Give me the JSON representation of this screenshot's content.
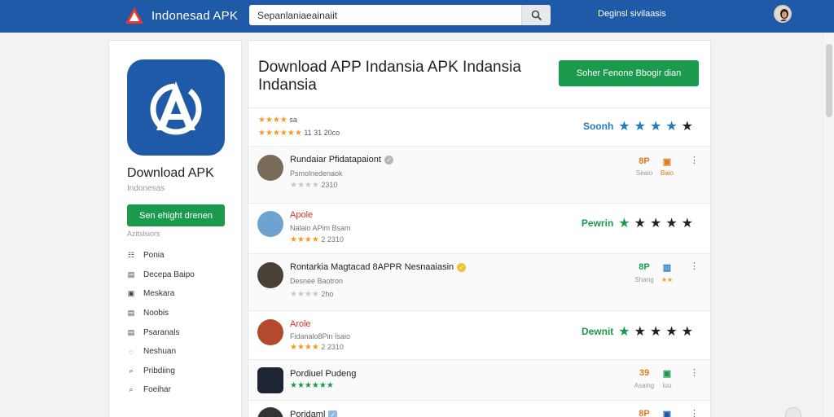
{
  "header": {
    "brand": "Indonesad APK",
    "search_value": "Sepanlaniaeainaiit",
    "link": "Deginsl sivilaasis"
  },
  "left": {
    "app_title": "Download APK",
    "app_sub": "Indonesas",
    "download_label": "Sen ehight drenen",
    "categories_heading": "Azitslsiors",
    "categories": [
      {
        "icon": "grid-icon",
        "glyph": "☷",
        "label": "Ponia"
      },
      {
        "icon": "calendar-icon",
        "glyph": "▤",
        "label": "Decepa Baipo"
      },
      {
        "icon": "media-icon",
        "glyph": "▣",
        "label": "Meskara"
      },
      {
        "icon": "news-icon",
        "glyph": "▤",
        "label": "Noobis"
      },
      {
        "icon": "list-icon",
        "glyph": "▤",
        "label": "Psaranals"
      },
      {
        "icon": "circle-icon",
        "glyph": "◌",
        "label": "Neshuan"
      },
      {
        "icon": "search-icon",
        "glyph": "⌕",
        "label": "Pribdiing"
      },
      {
        "icon": "search-icon",
        "glyph": "⌕",
        "label": "Foeihar"
      }
    ]
  },
  "main": {
    "title": "Download APP Indansia APK Indansia Indansia",
    "primary_button": "Soher Fenone Bbogir dian",
    "summary": {
      "line1_text": "sa",
      "line2_text": "11  31  20co",
      "rate_label": "Soonh",
      "rate_color": "#1e7bc4"
    },
    "rows": [
      {
        "name": "Rundaiar Pfidatapaiont",
        "sub": "Psmolnedenaok",
        "stars_text": "2310",
        "name_red": false,
        "verify_color": "#b5b5b5",
        "right_type": "stat",
        "num": "8P",
        "num_color": "#e07b1f",
        "num_sub": "Seaio",
        "icon_glyph": "▣",
        "icon_color": "#e07b1f",
        "icon_sub": "Baio",
        "avatar_color": "#7a6a58",
        "avatar_shape": "round"
      },
      {
        "name": "Apole",
        "sub": "Nalaio APim  Bsam",
        "stars_text": "2  2310",
        "name_red": true,
        "right_type": "rate",
        "rate_label": "Pewrin",
        "rate_color": "#1b9a4d",
        "avatar_color": "#6fa3cf",
        "avatar_shape": "round"
      },
      {
        "name": "Rontarkia Magtacad 8APPR Nesnaaiasin",
        "sub": "Desnee Baotron",
        "stars_text": "2ho",
        "name_red": false,
        "verify_color": "#f1c232",
        "right_type": "stat",
        "num": "8P",
        "num_color": "#1b9a4d",
        "num_sub": "Shang",
        "icon_glyph": "▥",
        "icon_color": "#1e7bc4",
        "icon_sub": "★★",
        "avatar_color": "#4a4136",
        "avatar_shape": "round"
      },
      {
        "name": "Arole",
        "sub": "Fidanalo8Pin  Isaio",
        "stars_text": "2  2310",
        "name_red": true,
        "right_type": "rate",
        "rate_label": "Dewnit",
        "rate_color": "#1b9a4d",
        "avatar_color": "#b34a2e",
        "avatar_shape": "round"
      },
      {
        "name": "Pordiuel Pudeng",
        "sub": "",
        "stars_text": "",
        "name_red": false,
        "right_type": "stat",
        "num": "39",
        "num_color": "#e07b1f",
        "num_sub": "Asaing",
        "icon_glyph": "▣",
        "icon_color": "#1b9a4d",
        "icon_sub": "Iuo",
        "avatar_color": "#1d2433",
        "avatar_shape": "square"
      },
      {
        "name": "Poridaml",
        "sub": "",
        "stars_text": "",
        "name_red": false,
        "verify_color": "#8fb8e0",
        "right_type": "stat",
        "num": "8P",
        "num_color": "#e07b1f",
        "num_sub": "",
        "icon_glyph": "▣",
        "icon_color": "#1e5aa8",
        "icon_sub": "",
        "avatar_color": "#333333",
        "avatar_shape": "round"
      }
    ]
  },
  "colors": {
    "brand_blue": "#1e5aa8",
    "accent_green": "#1b9a4d",
    "star_orange": "#f39c1b"
  }
}
